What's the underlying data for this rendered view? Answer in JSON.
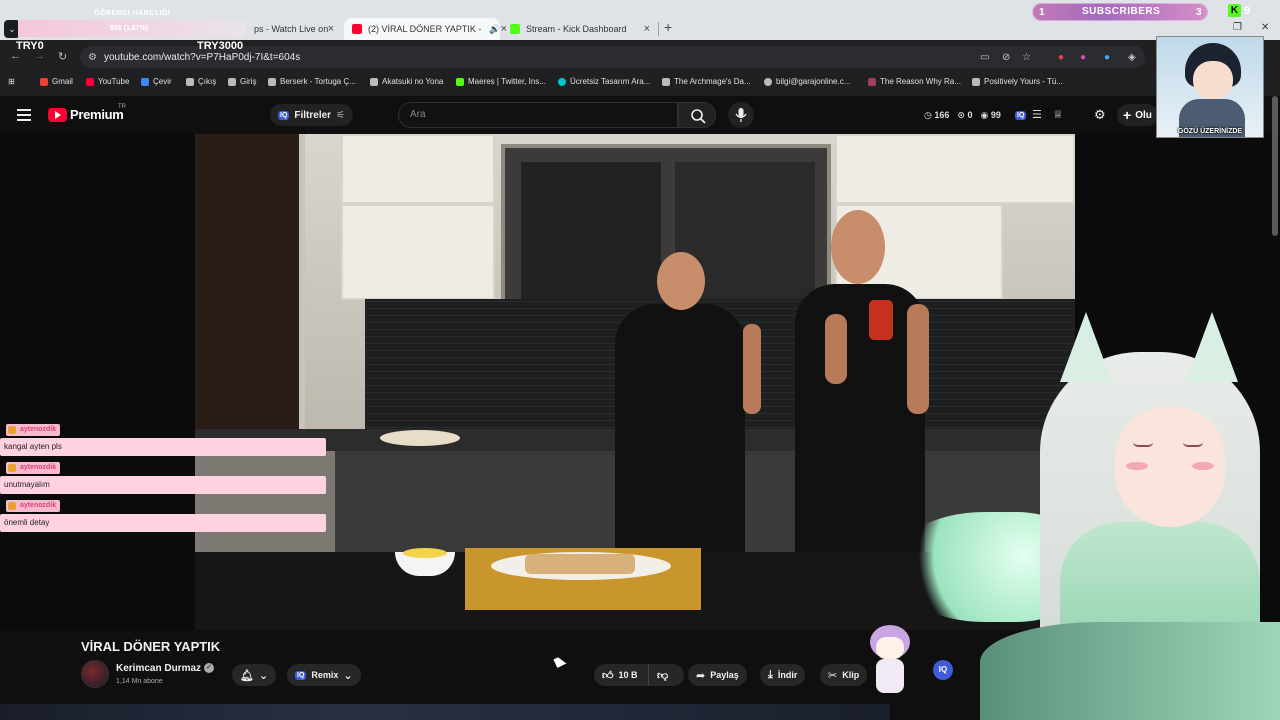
{
  "overlay": {
    "goal_title": "ÖĞRENCİ HARÇLIĞI",
    "goal_progress": "50$ (1.67%)",
    "subscribers_label": "SUBSCRIBERS",
    "subscribers_start": "1",
    "subscribers_end": "3",
    "kick_count": "9",
    "try_left": "TRY0",
    "try_right": "TRY3000",
    "cam_caption": "GÖZÜ ÜZERİNİZDE",
    "vtuber_icon": "vtuber-avatar"
  },
  "browser": {
    "tabs": [
      {
        "label": "ps - Watch Live on K",
        "close": "×",
        "icon_color": "#53fc18"
      },
      {
        "label": "(2) VİRAL DÖNER YAPTIK -",
        "close": "×",
        "icon_color": "#ff0033",
        "active": true
      },
      {
        "label": "Stream - Kick Dashboard",
        "close": "×",
        "icon_color": "#53fc18"
      }
    ],
    "new_tab": "+",
    "url": "youtube.com/watch?v=P7HaP0dj-7I&t=604s",
    "bookmarks": [
      {
        "label": "Gmail",
        "color": "#ea4335"
      },
      {
        "label": "YouTube",
        "color": "#ff0033"
      },
      {
        "label": "Çevir",
        "color": "#4285f4"
      },
      {
        "label": "Çıkış",
        "color": "#bbbbbb"
      },
      {
        "label": "Giriş",
        "color": "#bbbbbb"
      },
      {
        "label": "Berserk - Tortuga Ç...",
        "color": "#bbbbbb"
      },
      {
        "label": "Akatsuki no Yona",
        "color": "#bbbbbb"
      },
      {
        "label": "Maeres | Twitter, Ins...",
        "color": "#53fc18"
      },
      {
        "label": "Ücretsiz Tasarım Ara...",
        "color": "#00c4cc"
      },
      {
        "label": "The Archmage's Da...",
        "color": "#bbbbbb"
      },
      {
        "label": "bilgi@garajonline.c...",
        "color": "#bbbbbb"
      },
      {
        "label": "The Reason Why Ra...",
        "color": "#a04060"
      },
      {
        "label": "Positively Yours - Tü...",
        "color": "#bbbbbb"
      }
    ]
  },
  "youtube": {
    "logo_text": "Premium",
    "region": "TR",
    "filters_label": "Filtreler",
    "iq_badge": "IQ",
    "search_placeholder": "Ara",
    "stats": {
      "views": "166",
      "zero": "0",
      "ninety_nine": "99"
    },
    "create_label": "Olu"
  },
  "chat": [
    {
      "user": "aytenozdik",
      "text": "kangal ayten pls"
    },
    {
      "user": "aytenozdik",
      "text": "unutmayalım"
    },
    {
      "user": "aytenozdik",
      "text": "önemli detay"
    }
  ],
  "video": {
    "title": "VİRAL DÖNER YAPTIK",
    "channel": "Kerimcan Durmaz",
    "subscribers": "1,14 Mn abone",
    "remix_label": "Remix",
    "likes": "10 B",
    "share_label": "Paylaş",
    "download_label": "İndir",
    "clip_label": "Klip"
  },
  "colors": {
    "accent": "#ff0033",
    "kick": "#53fc18",
    "chat_bg": "#ffd2df",
    "iq": "#3f5bd8"
  }
}
